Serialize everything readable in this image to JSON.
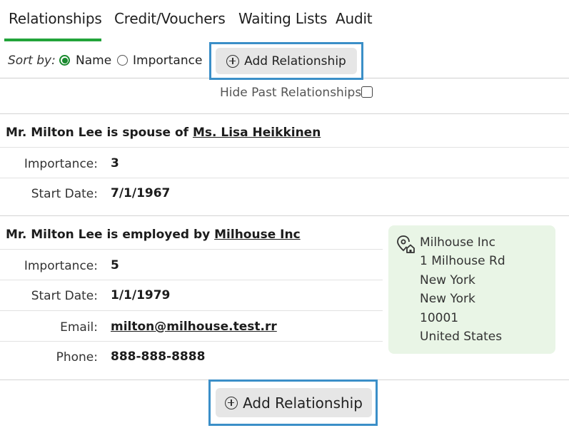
{
  "tabs": [
    {
      "label": "Relationships"
    },
    {
      "label": "Credit/Vouchers"
    },
    {
      "label": "Waiting Lists"
    },
    {
      "label": "Audit"
    }
  ],
  "sort": {
    "label": "Sort by:",
    "options": [
      {
        "label": "Name",
        "selected": true
      },
      {
        "label": "Importance",
        "selected": false
      }
    ]
  },
  "add_relationship_label": "Add Relationship",
  "hide_past_label": "Hide Past Relationships",
  "hide_past_checked": false,
  "relationships": [
    {
      "prefix": "Mr. Milton Lee is spouse of ",
      "target": "Ms. Lisa Heikkinen",
      "fields": [
        {
          "label": "Importance:",
          "value": "3"
        },
        {
          "label": "Start Date:",
          "value": "7/1/1967"
        }
      ]
    },
    {
      "prefix": "Mr. Milton Lee is employed by ",
      "target": "Milhouse Inc",
      "fields": [
        {
          "label": "Importance:",
          "value": "5"
        },
        {
          "label": "Start Date:",
          "value": "1/1/1979"
        },
        {
          "label": "Email:",
          "value": "milton@milhouse.test.rr"
        },
        {
          "label": "Phone:",
          "value": "888-888-8888"
        }
      ],
      "address": [
        "Milhouse Inc",
        "1 Milhouse Rd",
        "New York",
        "New York",
        "10001",
        "United States"
      ]
    }
  ],
  "colors": {
    "accent": "#22a43a",
    "radio_selected": "#1a8a2e",
    "highlight_frame": "#3b8fc8",
    "address_card_bg": "#e9f5e6",
    "button_bg": "#e6e6e6"
  },
  "icons": {
    "add": "plus-circle-icon",
    "address": "location-home-icon"
  }
}
